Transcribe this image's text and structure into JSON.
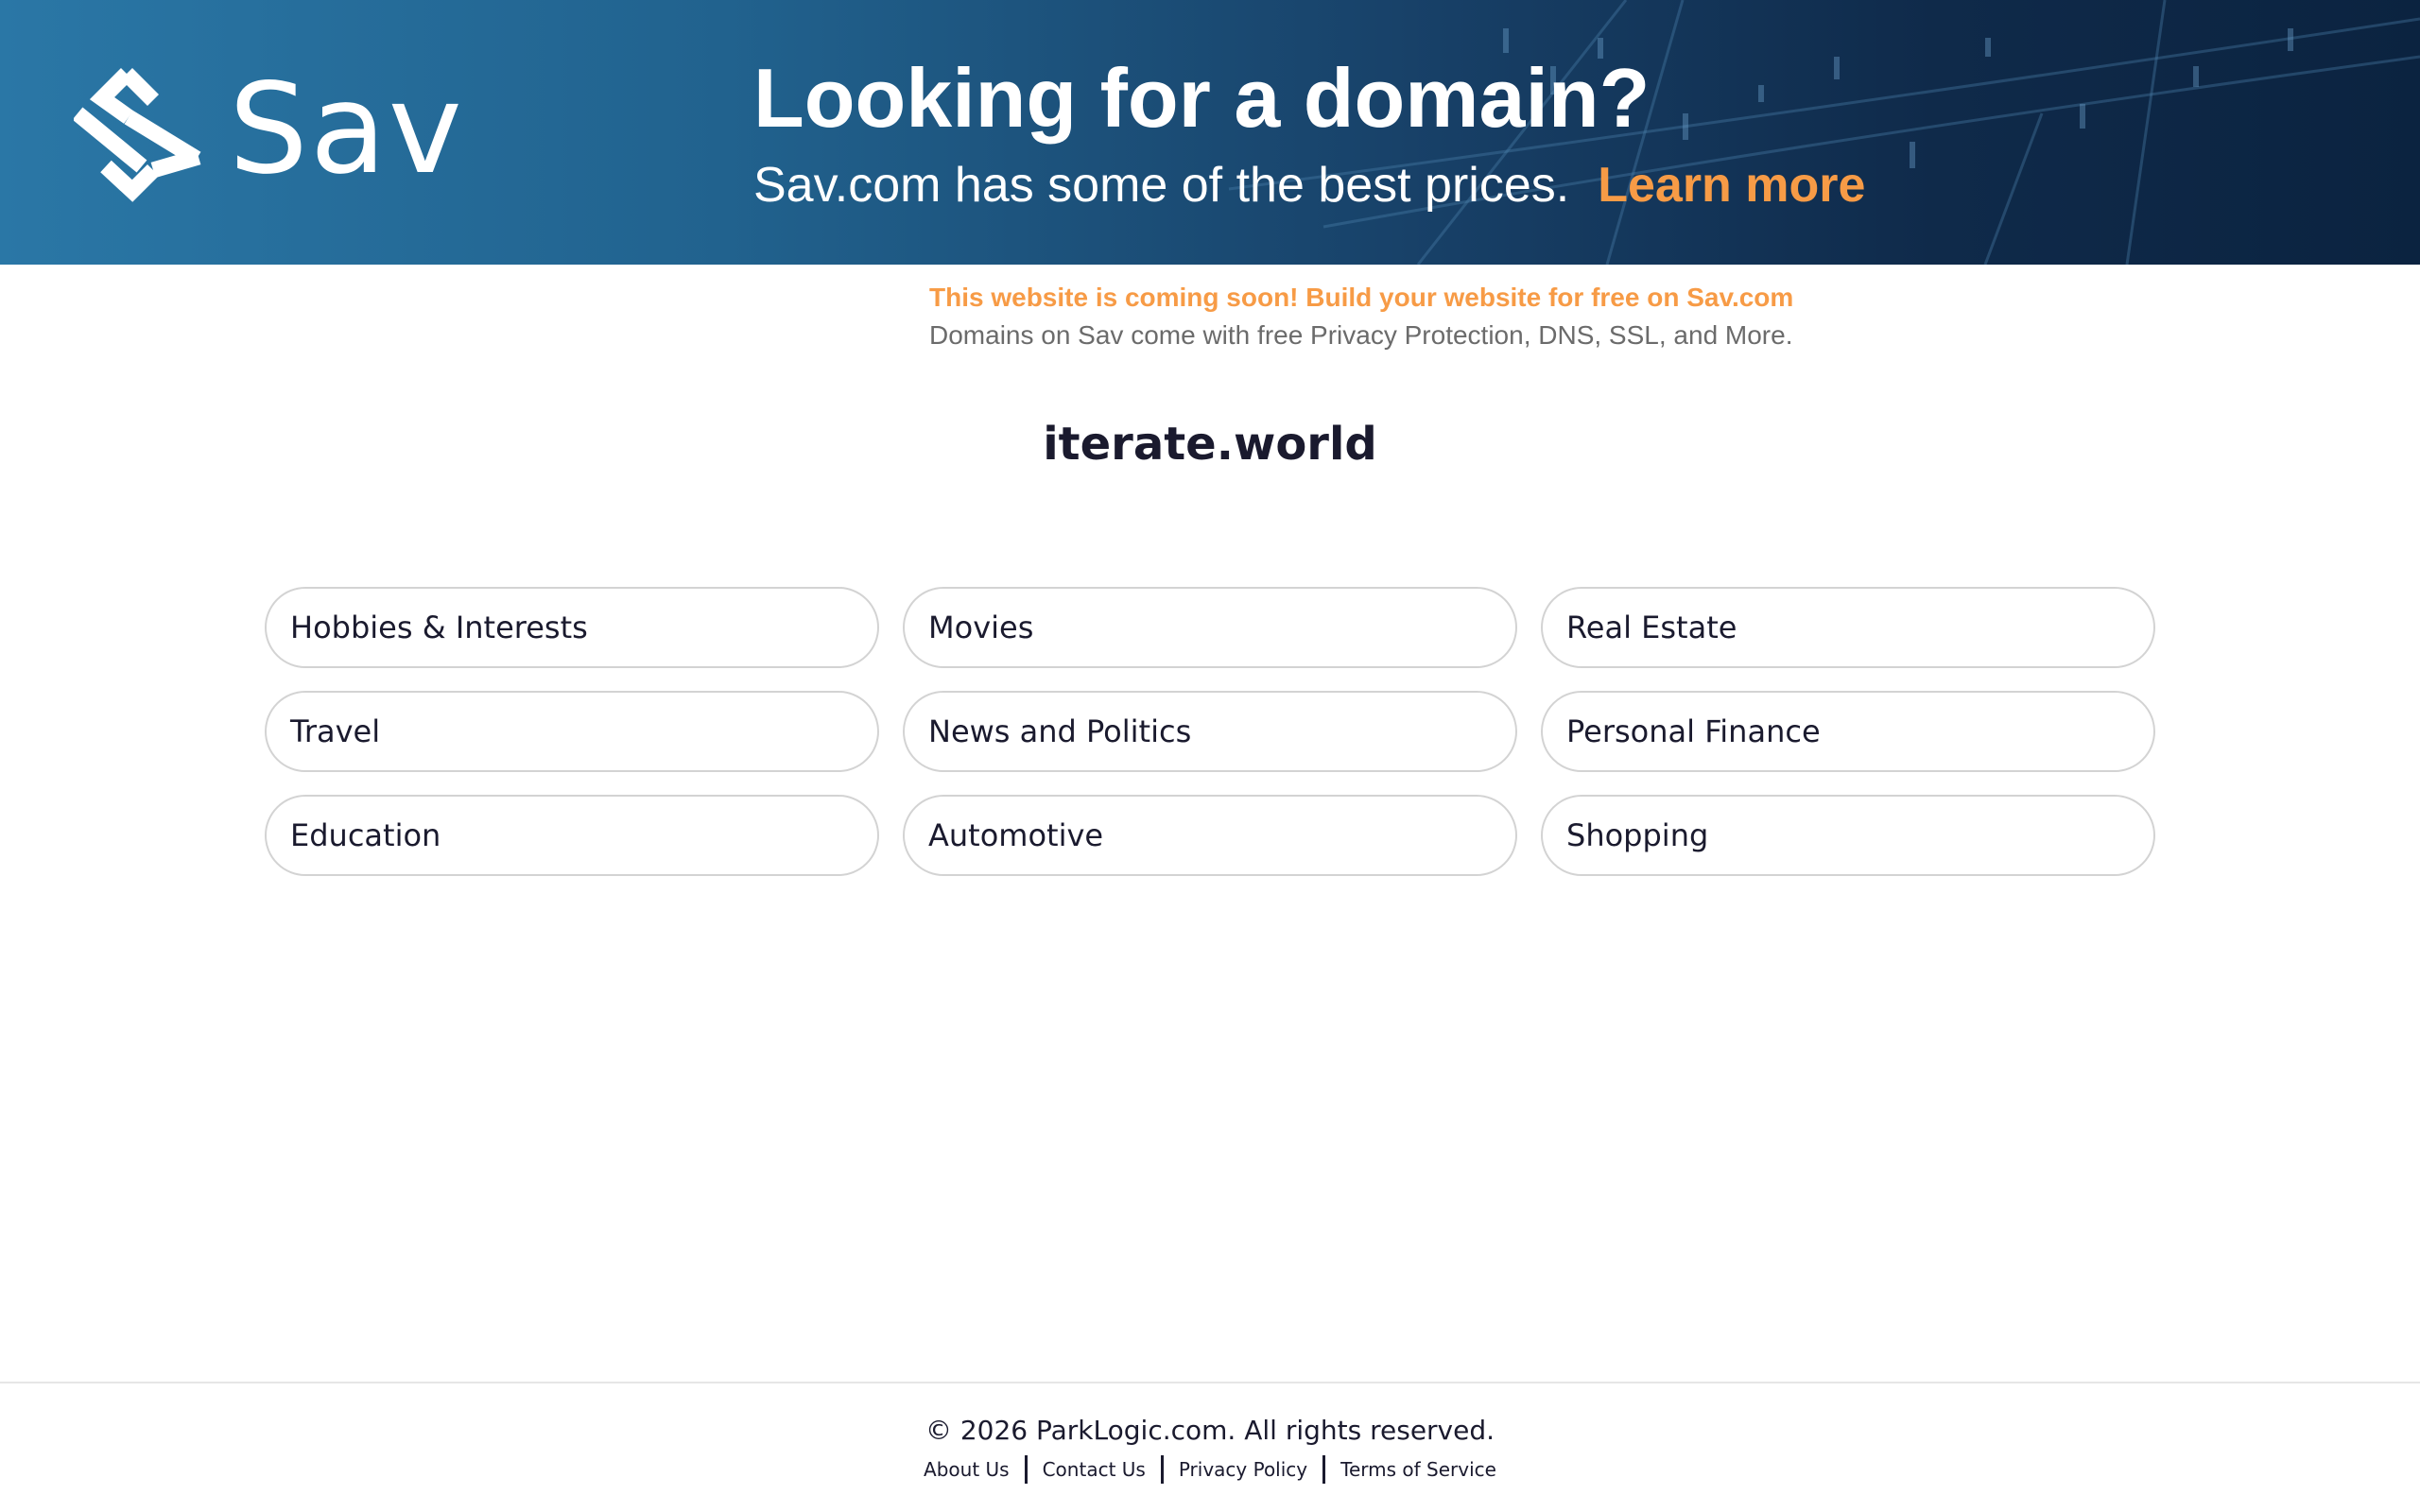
{
  "banner": {
    "logo_text": "Sav",
    "headline": "Looking for a domain?",
    "subline": "Sav.com has some of the best prices.",
    "cta": "Learn more",
    "accent_color": "#f79b46"
  },
  "notice": {
    "promo": "This website is coming soon! Build your website for free on Sav.com",
    "sub": "Domains on Sav come with free Privacy Protection, DNS, SSL, and More."
  },
  "domain": "iterate.world",
  "categories": [
    "Hobbies & Interests",
    "Movies",
    "Real Estate",
    "Travel",
    "News and Politics",
    "Personal Finance",
    "Education",
    "Automotive",
    "Shopping"
  ],
  "footer": {
    "copyright": "© 2026 ParkLogic.com. All rights reserved.",
    "links": [
      "About Us",
      "Contact Us",
      "Privacy Policy",
      "Terms of Service"
    ]
  }
}
